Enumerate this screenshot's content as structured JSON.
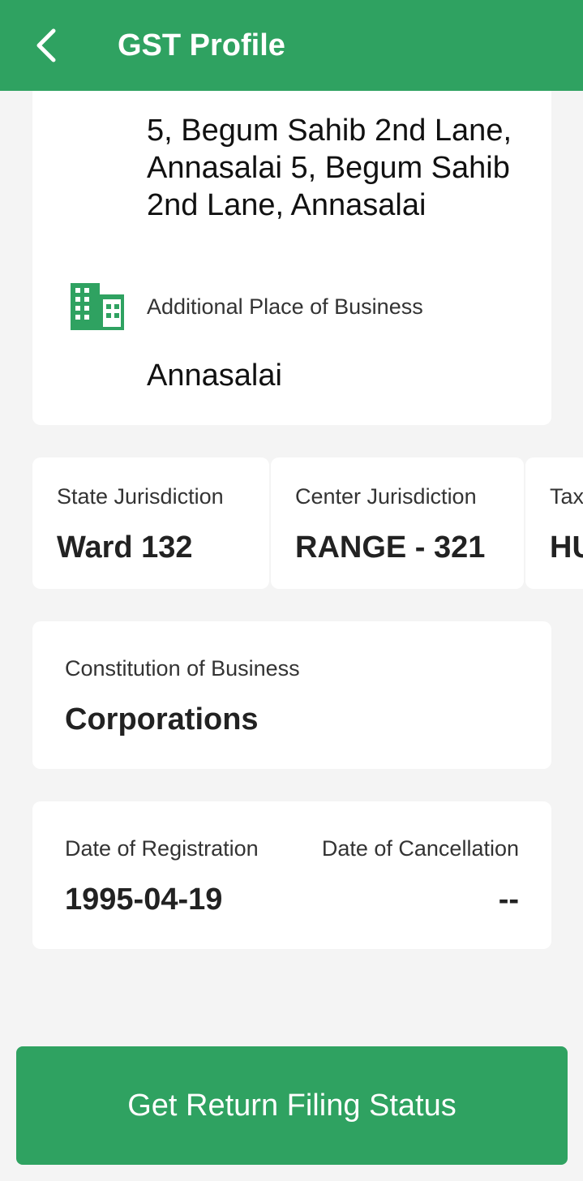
{
  "appbar": {
    "title": "GST Profile",
    "back_icon": "chevron-left-icon"
  },
  "address": {
    "principal_place": "5, Begum Sahib 2nd Lane, Annasalai 5, Begum Sahib 2nd Lane, Annasalai",
    "additional_label": "Additional Place of Business",
    "additional_value": "Annasalai",
    "icon": "building-icon"
  },
  "jurisdiction": [
    {
      "label": "State Jurisdiction",
      "value": "Ward 132"
    },
    {
      "label": "Center Jurisdiction",
      "value": "RANGE - 321"
    },
    {
      "label": "Tax",
      "value": "HU"
    }
  ],
  "constitution": {
    "label": "Constitution of Business",
    "value": "Corporations"
  },
  "dates": {
    "registration_label": "Date of Registration",
    "registration_value": "1995-04-19",
    "cancellation_label": "Date of Cancellation",
    "cancellation_value": "--"
  },
  "cta": {
    "label": "Get Return Filing Status"
  },
  "colors": {
    "primary": "#2fa261",
    "background": "#f4f4f4",
    "card": "#ffffff"
  }
}
